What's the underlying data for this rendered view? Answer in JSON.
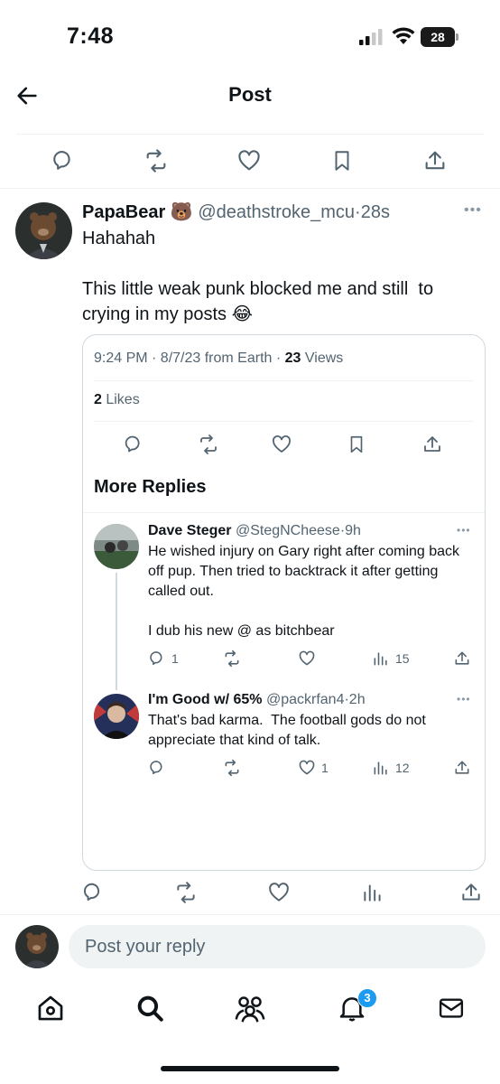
{
  "status_bar": {
    "time": "7:48",
    "battery": "28"
  },
  "header": {
    "title": "Post"
  },
  "main_tweet": {
    "name": "PapaBear",
    "emoji": "🐻",
    "handle": "@deathstroke_mcu",
    "time": "28s",
    "text": "Hahahah\n\nThis little weak punk blocked me and still  to crying in my posts 😂"
  },
  "quoted": {
    "meta_time": "9:24 PM · 8/7/23 from Earth · ",
    "views_count": "23",
    "views_label": " Views",
    "likes_count": "2",
    "likes_label": " Likes",
    "more_replies": "More Replies"
  },
  "replies": [
    {
      "name": "Dave Steger",
      "handle": "@StegNCheese",
      "time": "9h",
      "text": "He wished injury on Gary right after coming back off pup. Then tried to backtrack it after getting called out.\n\nI dub his new @ as bitchbear",
      "reply_count": "1",
      "like_count": "",
      "view_count": "15"
    },
    {
      "name": "I'm Good w/ 65%",
      "handle": "@packrfan4",
      "time": "2h",
      "text": "That's bad karma.  The football gods do not appreciate that kind of talk.",
      "reply_count": "",
      "like_count": "1",
      "view_count": "12"
    }
  ],
  "composer": {
    "placeholder": "Post your reply"
  },
  "tabbar": {
    "notifications_badge": "3"
  },
  "colors": {
    "accent": "#1d9bf0",
    "muted": "#536471",
    "border": "#cfd9de"
  }
}
